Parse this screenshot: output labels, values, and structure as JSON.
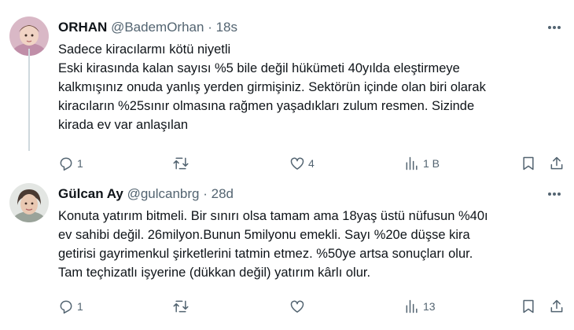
{
  "tweets": [
    {
      "name": "ORHAN",
      "handle": "@BademOrhan",
      "separator": "·",
      "time": "18s",
      "lines": [
        "Sadece kiracılarmı kötü niyetli",
        "Eski kirasında kalan sayısı %5 bile değil hükümeti 40yılda eleştirmeye",
        "kalkmışınız onuda yanlış yerden girmişiniz. Sektörün içinde olan biri olarak",
        "kiracıların %25sınır olmasına rağmen yaşadıkları zulum resmen. Sizinde",
        "kirada ev var anlaşılan"
      ],
      "stats": {
        "replies": "1",
        "retweets": "",
        "likes": "4",
        "views": "1 B"
      }
    },
    {
      "name": "Gülcan Ay",
      "handle": "@gulcanbrg",
      "separator": "·",
      "time": "28d",
      "lines": [
        "Konuta yatırım bitmeli. Bir sınırı olsa tamam ama 18yaş üstü nüfusun %40ı",
        "ev sahibi değil. 26milyon.Bunun 5milyonu emekli. Sayı %20e düşse kira",
        "getirisi gayrimenkul şirketlerini tatmin etmez. %50ye artsa sonuçları olur.",
        "Tam teçhizatlı işyerine (dükkan değil) yatırım kârlı olur."
      ],
      "stats": {
        "replies": "1",
        "retweets": "",
        "likes": "",
        "views": "13"
      }
    }
  ],
  "colors": {
    "text": "#0f1419",
    "secondary": "#536471",
    "divider": "#cfd9de"
  },
  "icons": [
    "avatar",
    "more-icon",
    "reply-icon",
    "retweet-icon",
    "like-icon",
    "views-icon",
    "bookmark-icon",
    "share-icon"
  ]
}
